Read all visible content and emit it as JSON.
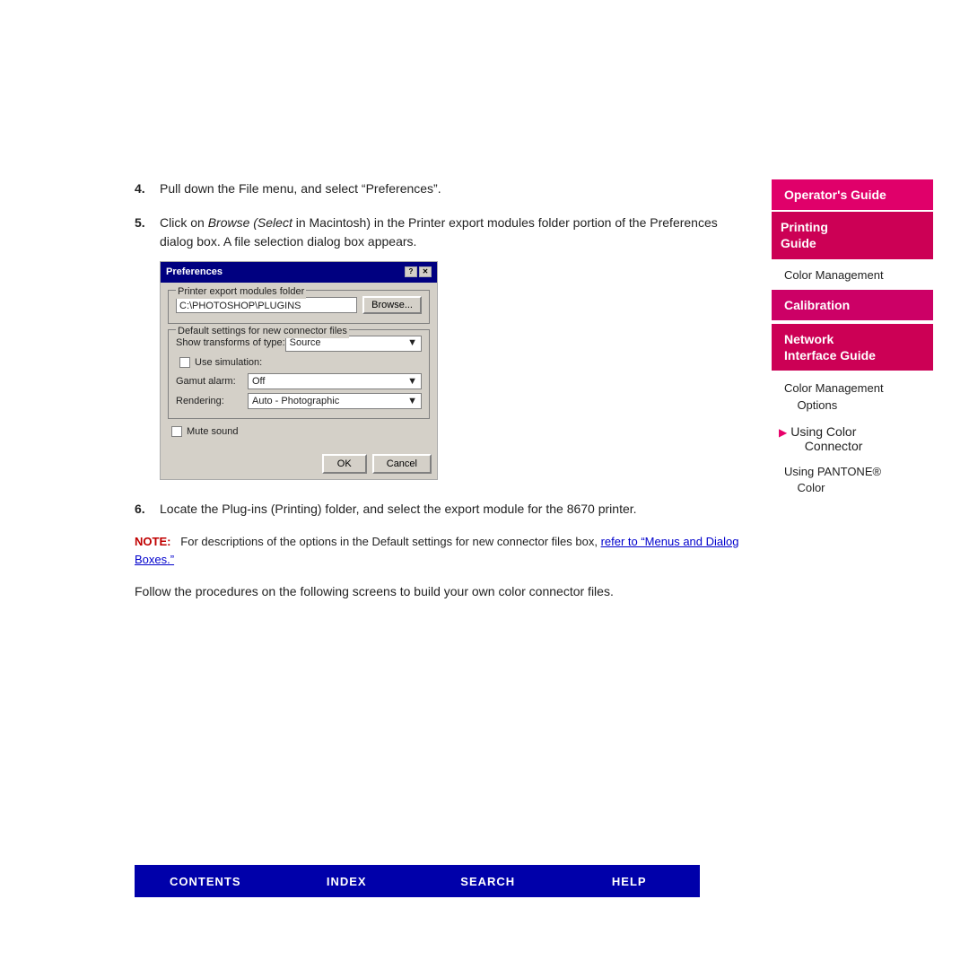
{
  "top_space": 200,
  "steps": [
    {
      "number": "4.",
      "text": "Pull down the File menu, and select “Preferences”."
    },
    {
      "number": "5.",
      "text_before": "Click on ",
      "text_italic": "Browse (Select",
      "text_after": " in Macintosh) in the Printer export modules folder portion of the Preferences dialog box. A file selection dialog box appears."
    },
    {
      "number": "6.",
      "text": "Locate the Plug-ins (Printing) folder, and select the export module for the 8670 printer."
    }
  ],
  "dialog": {
    "title": "Preferences",
    "titlebar_buttons": [
      "?",
      "×"
    ],
    "group1_label": "Printer export modules folder",
    "path_value": "C:\\PHOTOSHOP\\PLUGINS",
    "browse_btn": "Browse...",
    "group2_label": "Default settings for new connector files",
    "show_transforms_label": "Show transforms of type:",
    "show_transforms_value": "Source",
    "use_simulation_label": "Use simulation:",
    "gamut_alarm_label": "Gamut alarm:",
    "gamut_alarm_value": "Off",
    "rendering_label": "Rendering:",
    "rendering_value": "Auto - Photographic",
    "mute_sound_label": "Mute sound",
    "ok_btn": "OK",
    "cancel_btn": "Cancel"
  },
  "note": {
    "label": "NOTE:",
    "text": "  For descriptions of the options in the Default settings for new connector files box, ",
    "link_text": "refer to “Menus and Dialog Boxes.”"
  },
  "follow_text": "Follow the procedures on the following screens to build your own color connector files.",
  "sidebar": {
    "items": [
      {
        "label": "Operator’s Guide",
        "type": "pink",
        "active": false
      },
      {
        "label": "Printing\nGuide",
        "type": "pink",
        "active": true
      },
      {
        "label": "Color Management",
        "type": "sub",
        "active": false
      },
      {
        "label": "Calibration",
        "type": "magenta",
        "active": false
      },
      {
        "label": "Network\nInterface Guide",
        "type": "pink",
        "active": false
      },
      {
        "label": "Color Management\n    Options",
        "type": "sub",
        "active": false
      },
      {
        "label": "Using Color\n    Connector",
        "type": "sub-arrow",
        "active": true
      },
      {
        "label": "Using PANTONE®\n    Color",
        "type": "sub",
        "active": false
      }
    ]
  },
  "bottom_nav": {
    "items": [
      "CONTENTS",
      "INDEX",
      "SEARCH",
      "HELP"
    ]
  }
}
